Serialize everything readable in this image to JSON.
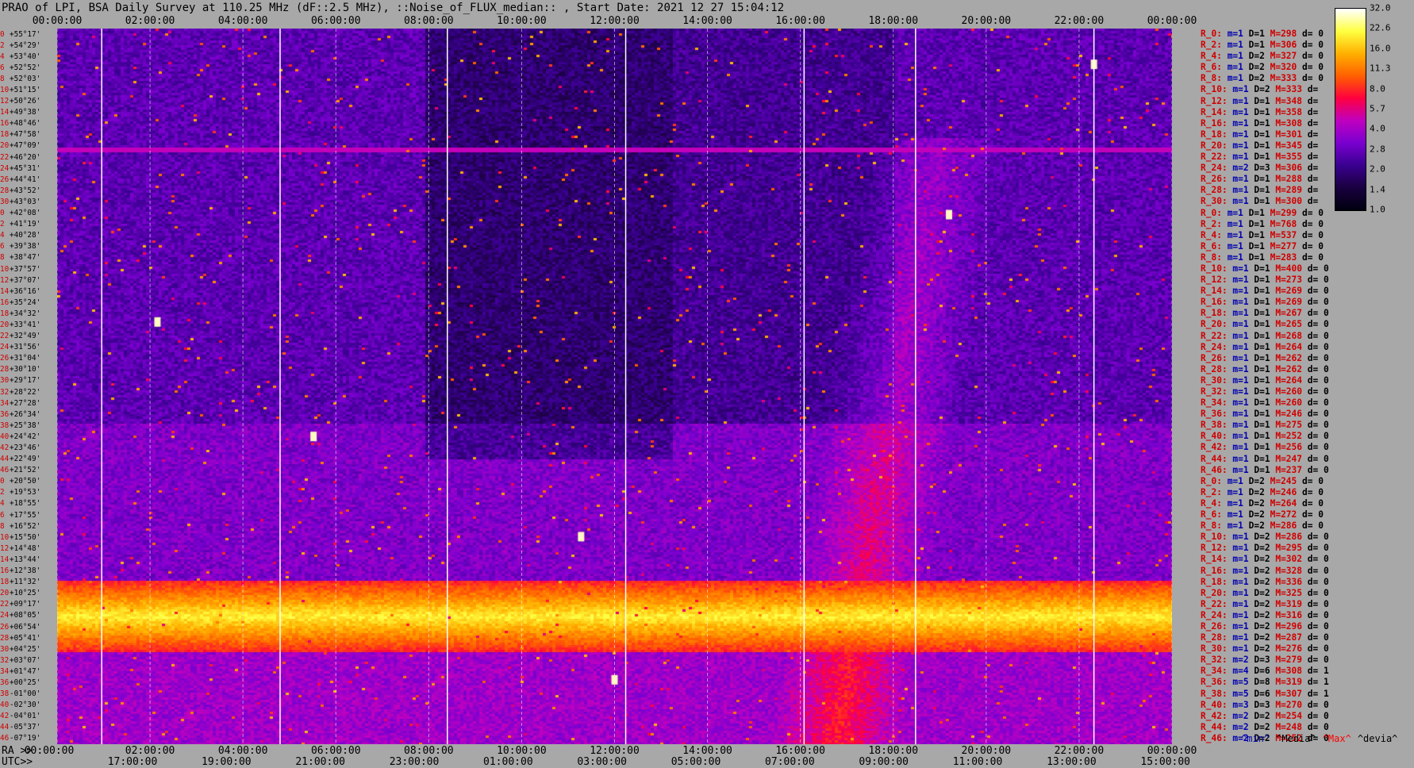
{
  "title": "PRAO of LPI, BSA Daily Survey at 110.25 MHz (dF::2.5 MHz), ::Noise_of_FLUX_median:: , Start Date: 2021 12 27 15:04:12",
  "chart_data": {
    "type": "heatmap",
    "title": "PRAO of LPI, BSA Daily Survey at 110.25 MHz (dF::2.5 MHz), ::Noise_of_FLUX_median:: , Start Date: 2021 12 27 15:04:12",
    "x_top_ticks": [
      "00:00:00",
      "02:00:00",
      "04:00:00",
      "06:00:00",
      "08:00:00",
      "10:00:00",
      "12:00:00",
      "14:00:00",
      "16:00:00",
      "18:00:00",
      "20:00:00",
      "22:00:00",
      "00:00:00"
    ],
    "x_ra_ticks": [
      "00:00:00",
      "02:00:00",
      "04:00:00",
      "06:00:00",
      "08:00:00",
      "10:00:00",
      "12:00:00",
      "14:00:00",
      "16:00:00",
      "18:00:00",
      "20:00:00",
      "22:00:00",
      "00:00:00"
    ],
    "x_utc_ticks": [
      "17:00:00",
      "19:00:00",
      "21:00:00",
      "23:00:00",
      "01:00:00",
      "03:00:00",
      "05:00:00",
      "07:00:00",
      "09:00:00",
      "11:00:00",
      "13:00:00",
      "15:00:00"
    ],
    "ra_label": "RA >>",
    "utc_label": "UTC>>",
    "y_rows": [
      {
        "i": "0",
        "dec": "+55°17'"
      },
      {
        "i": "2",
        "dec": "+54°29'"
      },
      {
        "i": "4",
        "dec": "+53°40'"
      },
      {
        "i": "6",
        "dec": "+52°52'"
      },
      {
        "i": "8",
        "dec": "+52°03'"
      },
      {
        "i": "10",
        "dec": "+51°15'"
      },
      {
        "i": "12",
        "dec": "+50°26'"
      },
      {
        "i": "14",
        "dec": "+49°38'"
      },
      {
        "i": "16",
        "dec": "+48°46'"
      },
      {
        "i": "18",
        "dec": "+47°58'"
      },
      {
        "i": "20",
        "dec": "+47°09'"
      },
      {
        "i": "22",
        "dec": "+46°20'"
      },
      {
        "i": "24",
        "dec": "+45°31'"
      },
      {
        "i": "26",
        "dec": "+44°41'"
      },
      {
        "i": "28",
        "dec": "+43°52'"
      },
      {
        "i": "30",
        "dec": "+43°03'"
      },
      {
        "i": "0",
        "dec": "+42°08'"
      },
      {
        "i": "2",
        "dec": "+41°19'"
      },
      {
        "i": "4",
        "dec": "+40°28'"
      },
      {
        "i": "6",
        "dec": "+39°38'"
      },
      {
        "i": "8",
        "dec": "+38°47'"
      },
      {
        "i": "10",
        "dec": "+37°57'"
      },
      {
        "i": "12",
        "dec": "+37°07'"
      },
      {
        "i": "14",
        "dec": "+36°16'"
      },
      {
        "i": "16",
        "dec": "+35°24'"
      },
      {
        "i": "18",
        "dec": "+34°32'"
      },
      {
        "i": "20",
        "dec": "+33°41'"
      },
      {
        "i": "22",
        "dec": "+32°49'"
      },
      {
        "i": "24",
        "dec": "+31°56'"
      },
      {
        "i": "26",
        "dec": "+31°04'"
      },
      {
        "i": "28",
        "dec": "+30°10'"
      },
      {
        "i": "30",
        "dec": "+29°17'"
      },
      {
        "i": "32",
        "dec": "+28°22'"
      },
      {
        "i": "34",
        "dec": "+27°28'"
      },
      {
        "i": "36",
        "dec": "+26°34'"
      },
      {
        "i": "38",
        "dec": "+25°38'"
      },
      {
        "i": "40",
        "dec": "+24°42'"
      },
      {
        "i": "42",
        "dec": "+23°46'"
      },
      {
        "i": "44",
        "dec": "+22°49'"
      },
      {
        "i": "46",
        "dec": "+21°52'"
      },
      {
        "i": "0",
        "dec": "+20°50'"
      },
      {
        "i": "2",
        "dec": "+19°53'"
      },
      {
        "i": "4",
        "dec": "+18°55'"
      },
      {
        "i": "6",
        "dec": "+17°55'"
      },
      {
        "i": "8",
        "dec": "+16°52'"
      },
      {
        "i": "10",
        "dec": "+15°50'"
      },
      {
        "i": "12",
        "dec": "+14°48'"
      },
      {
        "i": "14",
        "dec": "+13°44'"
      },
      {
        "i": "16",
        "dec": "+12°38'"
      },
      {
        "i": "18",
        "dec": "+11°32'"
      },
      {
        "i": "20",
        "dec": "+10°25'"
      },
      {
        "i": "22",
        "dec": "+09°17'"
      },
      {
        "i": "24",
        "dec": "+08°05'"
      },
      {
        "i": "26",
        "dec": "+06°54'"
      },
      {
        "i": "28",
        "dec": "+05°41'"
      },
      {
        "i": "30",
        "dec": "+04°25'"
      },
      {
        "i": "32",
        "dec": "+03°07'"
      },
      {
        "i": "34",
        "dec": "+01°47'"
      },
      {
        "i": "36",
        "dec": "+00°25'"
      },
      {
        "i": "38",
        "dec": "-01°00'"
      },
      {
        "i": "40",
        "dec": "-02°30'"
      },
      {
        "i": "42",
        "dec": "-04°01'"
      },
      {
        "i": "44",
        "dec": "-05°37'"
      },
      {
        "i": "46",
        "dec": "-07°19'"
      }
    ],
    "stats_rows": [
      {
        "r": "R_0:",
        "m": "1",
        "D": "1",
        "M": "298",
        "d": "0"
      },
      {
        "r": "R_2:",
        "m": "1",
        "D": "1",
        "M": "306",
        "d": "0"
      },
      {
        "r": "R_4:",
        "m": "1",
        "D": "2",
        "M": "327",
        "d": "0"
      },
      {
        "r": "R_6:",
        "m": "1",
        "D": "2",
        "M": "320",
        "d": "0"
      },
      {
        "r": "R_8:",
        "m": "1",
        "D": "2",
        "M": "333",
        "d": "0"
      },
      {
        "r": "R_10:",
        "m": "1",
        "D": "2",
        "M": "333",
        "d": ""
      },
      {
        "r": "R_12:",
        "m": "1",
        "D": "1",
        "M": "348",
        "d": ""
      },
      {
        "r": "R_14:",
        "m": "1",
        "D": "1",
        "M": "358",
        "d": ""
      },
      {
        "r": "R_16:",
        "m": "1",
        "D": "1",
        "M": "308",
        "d": ""
      },
      {
        "r": "R_18:",
        "m": "1",
        "D": "1",
        "M": "301",
        "d": ""
      },
      {
        "r": "R_20:",
        "m": "1",
        "D": "1",
        "M": "345",
        "d": ""
      },
      {
        "r": "R_22:",
        "m": "1",
        "D": "1",
        "M": "355",
        "d": ""
      },
      {
        "r": "R_24:",
        "m": "2",
        "D": "3",
        "M": "306",
        "d": ""
      },
      {
        "r": "R_26:",
        "m": "1",
        "D": "1",
        "M": "288",
        "d": ""
      },
      {
        "r": "R_28:",
        "m": "1",
        "D": "1",
        "M": "289",
        "d": ""
      },
      {
        "r": "R_30:",
        "m": "1",
        "D": "1",
        "M": "300",
        "d": ""
      },
      {
        "r": "R_0:",
        "m": "1",
        "D": "1",
        "M": "299",
        "d": "0"
      },
      {
        "r": "R_2:",
        "m": "1",
        "D": "1",
        "M": "768",
        "d": "0"
      },
      {
        "r": "R_4:",
        "m": "1",
        "D": "1",
        "M": "537",
        "d": "0"
      },
      {
        "r": "R_6:",
        "m": "1",
        "D": "1",
        "M": "277",
        "d": "0"
      },
      {
        "r": "R_8:",
        "m": "1",
        "D": "1",
        "M": "283",
        "d": "0"
      },
      {
        "r": "R_10:",
        "m": "1",
        "D": "1",
        "M": "400",
        "d": "0"
      },
      {
        "r": "R_12:",
        "m": "1",
        "D": "1",
        "M": "273",
        "d": "0"
      },
      {
        "r": "R_14:",
        "m": "1",
        "D": "1",
        "M": "269",
        "d": "0"
      },
      {
        "r": "R_16:",
        "m": "1",
        "D": "1",
        "M": "269",
        "d": "0"
      },
      {
        "r": "R_18:",
        "m": "1",
        "D": "1",
        "M": "267",
        "d": "0"
      },
      {
        "r": "R_20:",
        "m": "1",
        "D": "1",
        "M": "265",
        "d": "0"
      },
      {
        "r": "R_22:",
        "m": "1",
        "D": "1",
        "M": "268",
        "d": "0"
      },
      {
        "r": "R_24:",
        "m": "1",
        "D": "1",
        "M": "264",
        "d": "0"
      },
      {
        "r": "R_26:",
        "m": "1",
        "D": "1",
        "M": "262",
        "d": "0"
      },
      {
        "r": "R_28:",
        "m": "1",
        "D": "1",
        "M": "262",
        "d": "0"
      },
      {
        "r": "R_30:",
        "m": "1",
        "D": "1",
        "M": "264",
        "d": "0"
      },
      {
        "r": "R_32:",
        "m": "1",
        "D": "1",
        "M": "260",
        "d": "0"
      },
      {
        "r": "R_34:",
        "m": "1",
        "D": "1",
        "M": "260",
        "d": "0"
      },
      {
        "r": "R_36:",
        "m": "1",
        "D": "1",
        "M": "246",
        "d": "0"
      },
      {
        "r": "R_38:",
        "m": "1",
        "D": "1",
        "M": "275",
        "d": "0"
      },
      {
        "r": "R_40:",
        "m": "1",
        "D": "1",
        "M": "252",
        "d": "0"
      },
      {
        "r": "R_42:",
        "m": "1",
        "D": "1",
        "M": "256",
        "d": "0"
      },
      {
        "r": "R_44:",
        "m": "1",
        "D": "1",
        "M": "247",
        "d": "0"
      },
      {
        "r": "R_46:",
        "m": "1",
        "D": "1",
        "M": "237",
        "d": "0"
      },
      {
        "r": "R_0:",
        "m": "1",
        "D": "2",
        "M": "245",
        "d": "0"
      },
      {
        "r": "R_2:",
        "m": "1",
        "D": "2",
        "M": "246",
        "d": "0"
      },
      {
        "r": "R_4:",
        "m": "1",
        "D": "2",
        "M": "264",
        "d": "0"
      },
      {
        "r": "R_6:",
        "m": "1",
        "D": "2",
        "M": "272",
        "d": "0"
      },
      {
        "r": "R_8:",
        "m": "1",
        "D": "2",
        "M": "286",
        "d": "0"
      },
      {
        "r": "R_10:",
        "m": "1",
        "D": "2",
        "M": "286",
        "d": "0"
      },
      {
        "r": "R_12:",
        "m": "1",
        "D": "2",
        "M": "295",
        "d": "0"
      },
      {
        "r": "R_14:",
        "m": "1",
        "D": "2",
        "M": "302",
        "d": "0"
      },
      {
        "r": "R_16:",
        "m": "1",
        "D": "2",
        "M": "328",
        "d": "0"
      },
      {
        "r": "R_18:",
        "m": "1",
        "D": "2",
        "M": "336",
        "d": "0"
      },
      {
        "r": "R_20:",
        "m": "1",
        "D": "2",
        "M": "325",
        "d": "0"
      },
      {
        "r": "R_22:",
        "m": "1",
        "D": "2",
        "M": "319",
        "d": "0"
      },
      {
        "r": "R_24:",
        "m": "1",
        "D": "2",
        "M": "316",
        "d": "0"
      },
      {
        "r": "R_26:",
        "m": "1",
        "D": "2",
        "M": "296",
        "d": "0"
      },
      {
        "r": "R_28:",
        "m": "1",
        "D": "2",
        "M": "287",
        "d": "0"
      },
      {
        "r": "R_30:",
        "m": "1",
        "D": "2",
        "M": "276",
        "d": "0"
      },
      {
        "r": "R_32:",
        "m": "2",
        "D": "3",
        "M": "279",
        "d": "0"
      },
      {
        "r": "R_34:",
        "m": "4",
        "D": "6",
        "M": "308",
        "d": "1"
      },
      {
        "r": "R_36:",
        "m": "5",
        "D": "8",
        "M": "319",
        "d": "1"
      },
      {
        "r": "R_38:",
        "m": "5",
        "D": "6",
        "M": "307",
        "d": "1"
      },
      {
        "r": "R_40:",
        "m": "3",
        "D": "3",
        "M": "270",
        "d": "0"
      },
      {
        "r": "R_42:",
        "m": "2",
        "D": "2",
        "M": "254",
        "d": "0"
      },
      {
        "r": "R_44:",
        "m": "2",
        "D": "2",
        "M": "248",
        "d": "0"
      },
      {
        "r": "R_46:",
        "m": "2",
        "D": "2",
        "M": "252",
        "d": "0"
      }
    ],
    "legend": [
      "^min^",
      "^Media^",
      "^Max^",
      "^devia^"
    ],
    "legend_colors": [
      "#0000b0",
      "#000000",
      "#ff0000",
      "#000000"
    ],
    "colorbar_ticks": [
      "32.0",
      "22.6",
      "16.0",
      "11.3",
      "8.0",
      "5.7",
      "4.0",
      "2.8",
      "2.0",
      "1.4",
      "1.0"
    ],
    "colorbar_scale": "log",
    "colormap": [
      "#000010",
      "#1a0040",
      "#3a0090",
      "#7a00d0",
      "#c000c0",
      "#ff0040",
      "#ff6000",
      "#ffb000",
      "#ffff40",
      "#ffffff"
    ],
    "grid": true
  }
}
